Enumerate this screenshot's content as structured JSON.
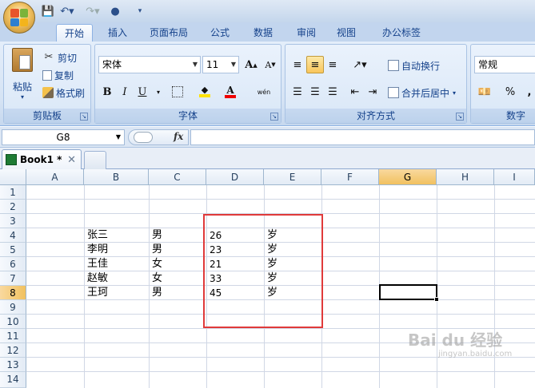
{
  "app": {
    "workbook_tab": "Book1 *"
  },
  "ribbon_tabs": [
    "开始",
    "插入",
    "页面布局",
    "公式",
    "数据",
    "审阅",
    "视图",
    "办公标签"
  ],
  "clipboard": {
    "paste": "粘贴",
    "cut": "剪切",
    "copy": "复制",
    "format_painter": "格式刷",
    "label": "剪贴板"
  },
  "font": {
    "name": "宋体",
    "size": "11",
    "label": "字体",
    "bold": "B",
    "italic": "I",
    "underline": "U",
    "grow": "A",
    "shrink": "A",
    "phonetic": "wén"
  },
  "alignment": {
    "wrap_text": "自动换行",
    "merge_center": "合并后居中",
    "label": "对齐方式"
  },
  "number": {
    "format": "常规",
    "percent": "%",
    "label": "数字"
  },
  "formula_bar": {
    "name_box": "G8",
    "fx": "fx",
    "value": ""
  },
  "columns": [
    "A",
    "B",
    "C",
    "D",
    "E",
    "F",
    "G",
    "H",
    "I"
  ],
  "rows": [
    "1",
    "2",
    "3",
    "4",
    "5",
    "6",
    "7",
    "8",
    "9",
    "10",
    "11",
    "12",
    "13",
    "14"
  ],
  "selected": {
    "column": "G",
    "row": "8"
  },
  "cells": {
    "B": [
      "张三",
      "李明",
      "王佳",
      "赵敏",
      "王珂"
    ],
    "C": [
      "男",
      "男",
      "女",
      "女",
      "男"
    ],
    "D": [
      "26",
      "23",
      "21",
      "33",
      "45"
    ],
    "E": [
      "岁",
      "岁",
      "岁",
      "岁",
      "岁"
    ]
  },
  "watermark": {
    "brand": "Bai du 经验",
    "url": "jingyan.baidu.com"
  },
  "colors": {
    "highlight_box": "#e03a3a",
    "ribbon_bg": "#d5e3f4",
    "selected_header": "#f1c15f"
  }
}
